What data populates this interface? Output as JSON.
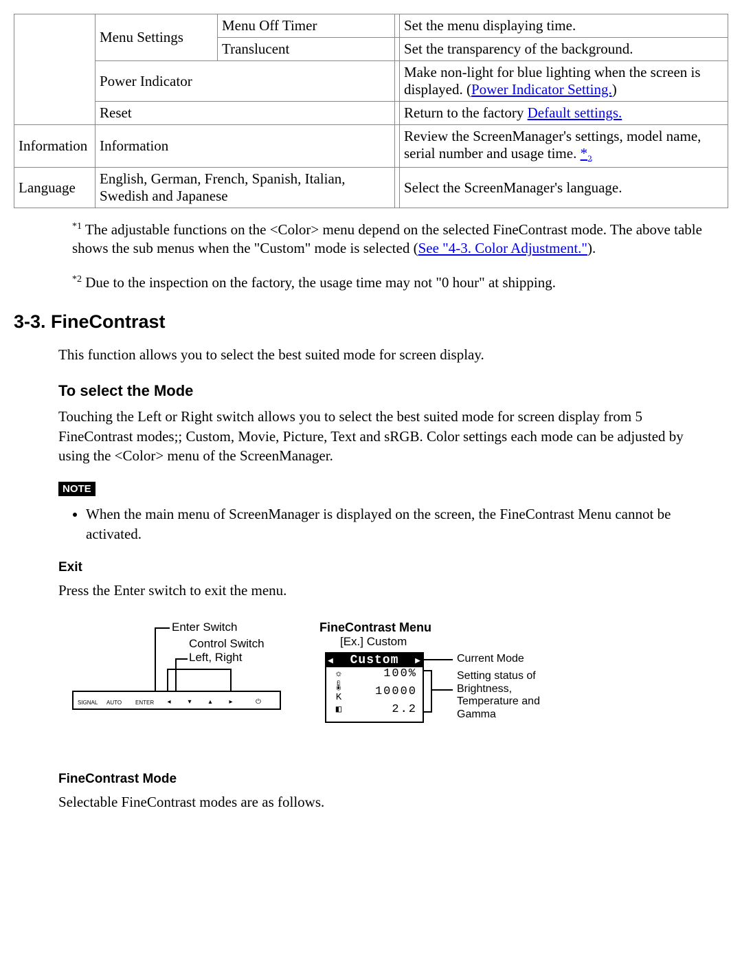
{
  "table": {
    "col1_blank": "",
    "menu_settings": "Menu Settings",
    "rows": [
      {
        "sub": "Menu Off Timer",
        "desc": "Set the menu displaying time."
      },
      {
        "sub": "Translucent",
        "desc": "Set the transparency of the background."
      }
    ],
    "power_indicator": {
      "label": "Power Indicator",
      "desc_pre": "Make non-light for blue lighting when the screen is displayed. (",
      "link": "Power Indicator Setting.",
      "desc_post": ")"
    },
    "reset": {
      "label": "Reset",
      "desc_pre": "Return to the factory ",
      "link": "Default settings."
    },
    "information": {
      "main": "Information",
      "sub": "Information",
      "desc": "Review the ScreenManager's settings, model name, serial number and usage time. ",
      "fn_mark": "*",
      "fn_num": "2"
    },
    "language": {
      "main": "Language",
      "sub": "English, German, French, Spanish, Italian, Swedish and Japanese",
      "desc": "Select the ScreenManager's language."
    }
  },
  "footnotes": {
    "f1_sup": "*1",
    "f1_text_a": " The adjustable functions on the <Color> menu depend on the selected FineContrast mode. The above table shows the sub menus when the \"Custom\" mode is selected (",
    "f1_link": "See \"4-3. Color Adjustment.\"",
    "f1_text_b": ").",
    "f2_sup": "*2",
    "f2_text": " Due to the inspection on the factory, the usage time may not \"0 hour\" at shipping."
  },
  "section_title": "3-3. FineContrast",
  "intro_para": "This function allows you to select the best suited mode for screen display.",
  "select_mode_head": "To select the Mode",
  "select_mode_para": "Touching the Left or Right switch allows you to select the best suited mode for screen display from 5 FineContrast modes;; Custom, Movie, Picture, Text and sRGB. Color settings each mode can be adjusted by using the <Color> menu of the ScreenManager.",
  "note_label": "NOTE",
  "note_bullet": "When the main menu of ScreenManager is displayed on the screen, the FineContrast Menu cannot be activated.",
  "exit_head": "Exit",
  "exit_para": "Press the Enter switch to exit the menu.",
  "left_diagram": {
    "enter": "Enter Switch",
    "control": "Control Switch",
    "lr": "Left, Right",
    "bar_labels": [
      "SIGNAL",
      "AUTO",
      "ENTER"
    ],
    "bar_syms": [
      "◂",
      "▾",
      "▴",
      "▸",
      "⏻"
    ]
  },
  "right_diagram": {
    "title": "FineContrast Menu",
    "example": "[Ex.] Custom",
    "mode": "Custom",
    "brightness": "100%",
    "temperature": "10000",
    "gamma": "2.2",
    "annot_mode": "Current Mode",
    "annot_settings": "Setting status of\nBrightness,\nTemperature and\nGamma"
  },
  "fc_mode_head": "FineContrast Mode",
  "fc_mode_para": "Selectable FineContrast modes are as follows."
}
